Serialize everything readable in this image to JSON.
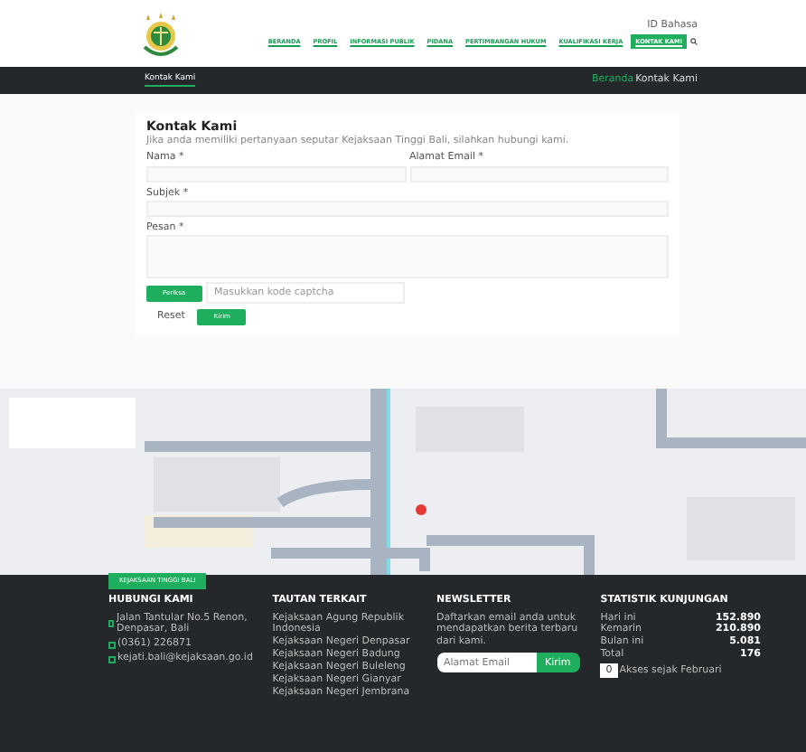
{
  "language": "ID Bahasa",
  "nav": [
    {
      "label": "BERANDA",
      "selected": false
    },
    {
      "label": "PROFIL",
      "selected": false
    },
    {
      "label": "INFORMASI PUBLIK",
      "selected": false
    },
    {
      "label": "PIDANA",
      "selected": false
    },
    {
      "label": "PERTIMBANGAN HUKUM",
      "selected": false
    },
    {
      "label": "KUALIFIKASI KERJA",
      "selected": false
    },
    {
      "label": "KONTAK KAMI",
      "selected": true
    }
  ],
  "page_title": "Kontak Kami",
  "breadcrumb": [
    "Beranda",
    "Kontak Kami"
  ],
  "form": {
    "title": "Kontak Kami",
    "intro": "Jika anda memiliki pertanyaan seputar Kejaksaan Tinggi Bali, silahkan hubungi kami.",
    "fields": [
      {
        "label": "Nama *",
        "kind": "input"
      },
      {
        "label": "Alamat Email *",
        "kind": "input"
      },
      {
        "label": "Subjek *",
        "kind": "input"
      },
      {
        "label": "Pesan *",
        "kind": "textarea"
      }
    ],
    "captcha_button": "Periksa",
    "captcha_placeholder": "Masukkan kode captcha",
    "reset": "Reset",
    "submit": "Kirim"
  },
  "footer": {
    "tag": "KEJAKSAAN TINGGI BALI",
    "contact": {
      "title": "HUBUNGI KAMI",
      "items": [
        "Jalan Tantular No.5 Renon, Denpasar, Bali",
        "(0361) 226871",
        "kejati.bali@kejaksaan.go.id"
      ]
    },
    "links": {
      "title": "TAUTAN TERKAIT",
      "items": [
        "Kejaksaan Agung Republik Indonesia",
        "Kejaksaan Negeri Denpasar",
        "Kejaksaan Negeri Badung",
        "Kejaksaan Negeri Buleleng",
        "Kejaksaan Negeri Gianyar",
        "Kejaksaan Negeri Jembrana"
      ]
    },
    "newsletter": {
      "title": "NEWSLETTER",
      "text": "Daftarkan email anda untuk mendapatkan berita terbaru dari kami.",
      "placeholder": "Alamat Email",
      "button": "Kirim"
    },
    "stats": {
      "title": "STATISTIK KUNJUNGAN",
      "rows": [
        {
          "label": "Hari ini",
          "value": "152.890"
        },
        {
          "label": "Kemarin",
          "value": "210.890"
        },
        {
          "label": "Bulan ini",
          "value": "5.081"
        },
        {
          "label": "Total",
          "value": "176"
        }
      ],
      "counter": "0",
      "counter_label": "Akses sejak Februari"
    }
  }
}
